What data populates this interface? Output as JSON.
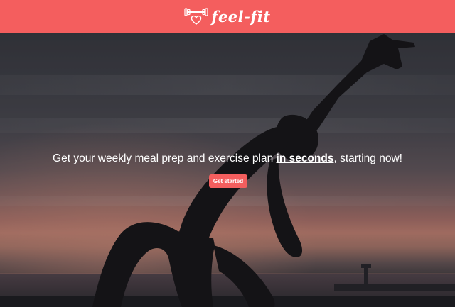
{
  "header": {
    "brand_name": "feel-fit",
    "logo_icon": "dumbbell-heart-icon",
    "background_color": "#f45e5e"
  },
  "hero": {
    "image": "yoga-silhouette-at-sunset",
    "tagline_before": "Get your weekly meal prep and exercise plan ",
    "tagline_emphasis": "in seconds",
    "tagline_after": ", starting now!",
    "cta_label": "Get started",
    "accent_color": "#f45e5e"
  }
}
